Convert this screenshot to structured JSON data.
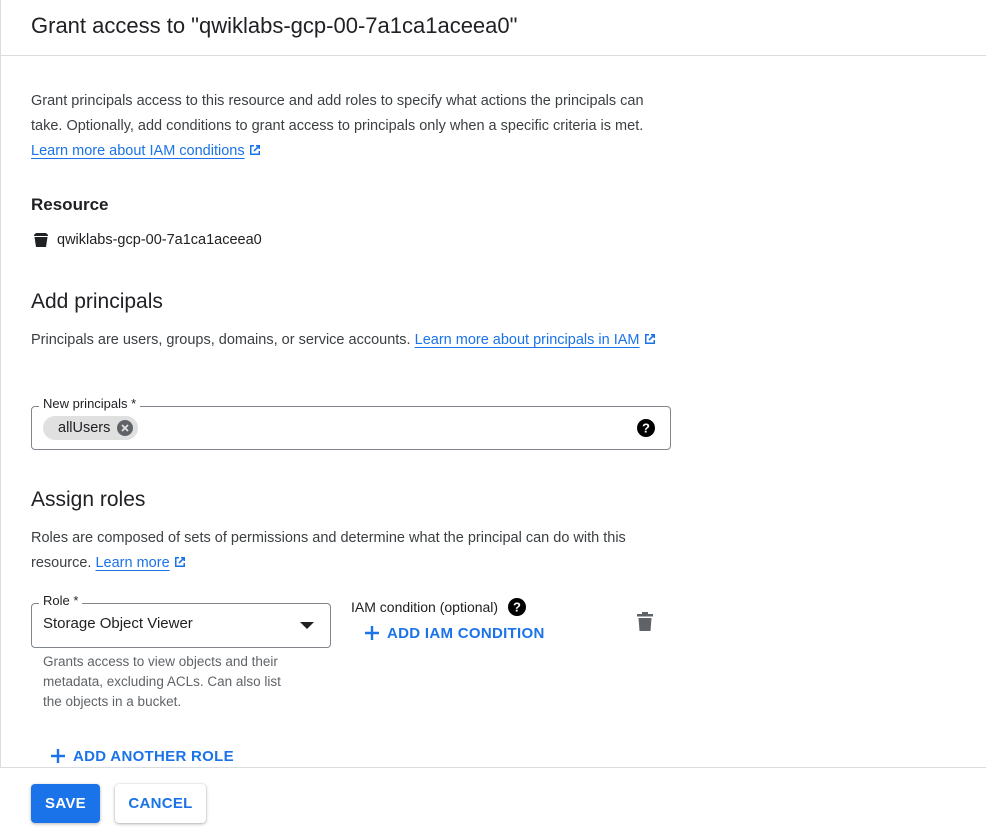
{
  "header": {
    "title": "Grant access to \"qwiklabs-gcp-00-7a1ca1aceea0\""
  },
  "intro": {
    "text": "Grant principals access to this resource and add roles to specify what actions the principals can take. Optionally, add conditions to grant access to principals only when a specific criteria is met.",
    "link": "Learn more about IAM conditions"
  },
  "resource": {
    "label": "Resource",
    "name": "qwiklabs-gcp-00-7a1ca1aceea0"
  },
  "principals": {
    "heading": "Add principals",
    "description": "Principals are users, groups, domains, or service accounts.",
    "link": "Learn more about principals in IAM",
    "field_label": "New principals *",
    "chips": [
      "allUsers"
    ]
  },
  "roles": {
    "heading": "Assign roles",
    "description": "Roles are composed of sets of permissions and determine what the principal can do with this resource.",
    "link": "Learn more",
    "role_label": "Role *",
    "role_value": "Storage Object Viewer",
    "role_hint": "Grants access to view objects and their metadata, excluding ACLs. Can also list the objects in a bucket.",
    "iam_condition_label": "IAM condition (optional)",
    "add_condition": "ADD IAM CONDITION",
    "add_another_role": "ADD ANOTHER ROLE"
  },
  "footer": {
    "save": "SAVE",
    "cancel": "CANCEL"
  },
  "colors": {
    "accent": "#1a73e8",
    "text": "#202124",
    "secondary": "#5f6368"
  }
}
